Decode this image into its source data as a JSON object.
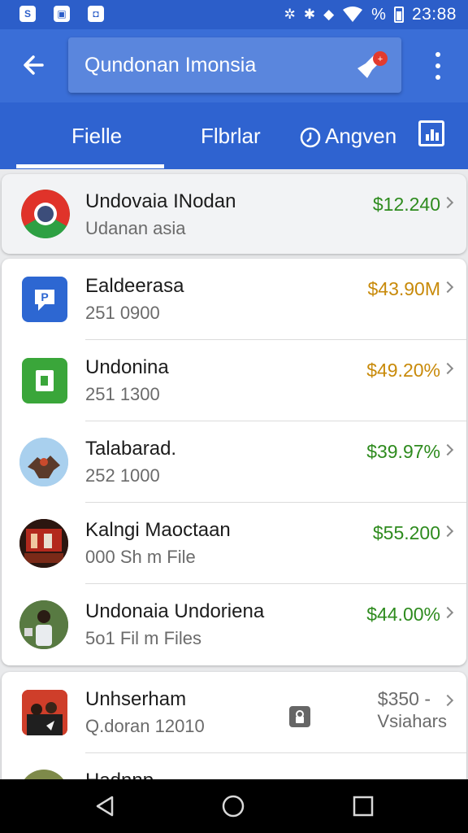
{
  "status_bar": {
    "left_icons": [
      "notification-s-icon",
      "image-icon",
      "cast-icon"
    ],
    "right_icons": [
      "nfc-icon",
      "bluetooth-icon",
      "signal-icon",
      "wifi-icon"
    ],
    "battery_text": "%",
    "time": "23:88"
  },
  "header": {
    "search_text": "Qundonan Imonsia",
    "notification_badge": "+"
  },
  "tabs": [
    {
      "label": "Fielle"
    },
    {
      "label": "Flbrlar"
    },
    {
      "label": "Angven"
    }
  ],
  "list_top": {
    "title": "Undovaia INodan",
    "subtitle": "Udanan asia",
    "value": "$12.240",
    "value_color": "#2e8b1e"
  },
  "list_main": [
    {
      "title": "Ealdeerasa",
      "subtitle": "251 0900",
      "value": "$43.90M",
      "value_color": "#c88a0a"
    },
    {
      "title": "Undonina",
      "subtitle": "251 1300",
      "value": "$49.20%",
      "value_color": "#c88a0a"
    },
    {
      "title": "Talabarad.",
      "subtitle": "252 1000",
      "value": "$39.97%",
      "value_color": "#2e8b1e"
    },
    {
      "title": "Kalngi Maoctaan",
      "subtitle": "000 Sh m File",
      "value": "$55.200",
      "value_color": "#2e8b1e"
    },
    {
      "title": "Undonaia Undoriena",
      "subtitle": "5o1 Fil m Files",
      "value": "$44.00%",
      "value_color": "#2e8b1e"
    }
  ],
  "list_bottom": [
    {
      "title": "Unhserham",
      "subtitle": "Q.doran 12010",
      "value_line1": "$350 -",
      "value_line2": "Vsiahars"
    },
    {
      "title": "Hadnnp"
    }
  ],
  "colors": {
    "primary": "#3a6ed7",
    "status_bar": "#2c5ec9",
    "green": "#2e8b1e",
    "amber": "#c88a0a"
  }
}
